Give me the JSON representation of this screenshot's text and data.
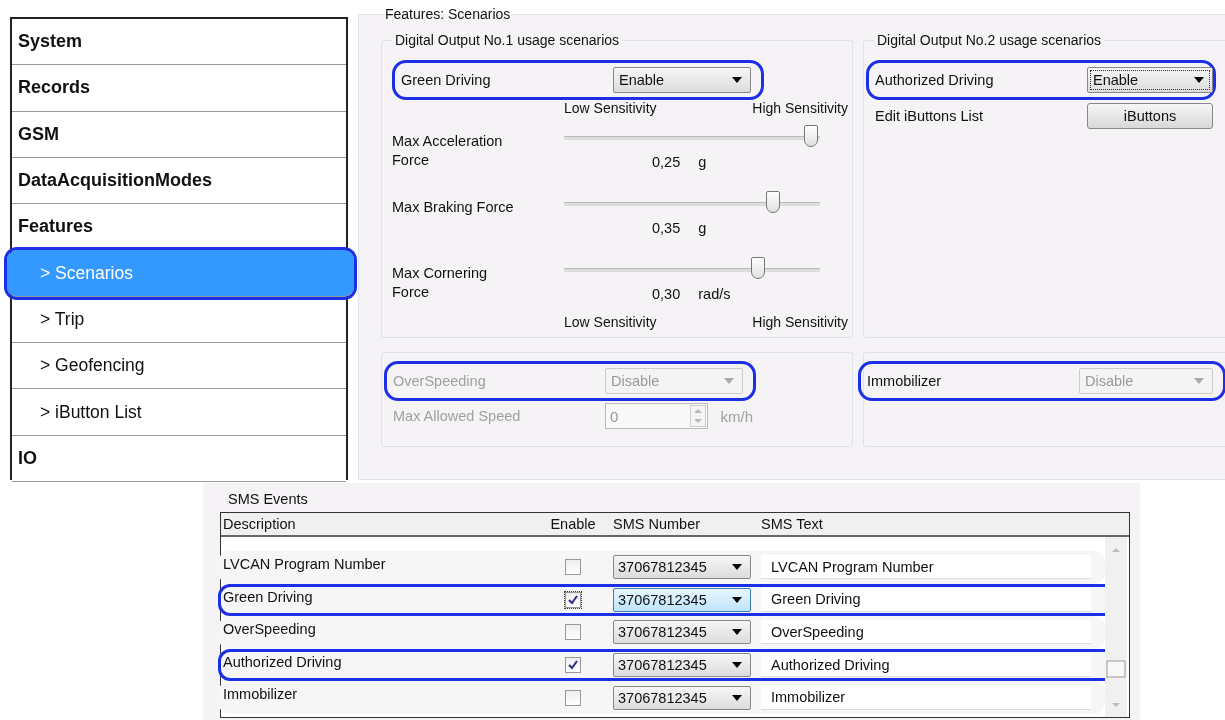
{
  "sidebar": {
    "items": [
      {
        "label": "System",
        "kind": "section",
        "selected": false,
        "highlighted": false
      },
      {
        "label": "Records",
        "kind": "section",
        "selected": false,
        "highlighted": false
      },
      {
        "label": "GSM",
        "kind": "section",
        "selected": false,
        "highlighted": false
      },
      {
        "label": "DataAcquisitionModes",
        "kind": "section",
        "selected": false,
        "highlighted": false
      },
      {
        "label": "Features",
        "kind": "section",
        "selected": false,
        "highlighted": false
      },
      {
        "label": "> Scenarios",
        "kind": "sub",
        "selected": true,
        "highlighted": true
      },
      {
        "label": "> Trip",
        "kind": "sub",
        "selected": false,
        "highlighted": false
      },
      {
        "label": "> Geofencing",
        "kind": "sub",
        "selected": false,
        "highlighted": false
      },
      {
        "label": "> iButton List",
        "kind": "sub",
        "selected": false,
        "highlighted": false
      },
      {
        "label": "IO",
        "kind": "section",
        "selected": false,
        "highlighted": false
      }
    ]
  },
  "features": {
    "title": "Features: Scenarios",
    "output_1": {
      "title": "Digital Output No.1 usage scenarios",
      "scenario": {
        "label": "Green Driving",
        "value": "Enable",
        "highlighted": true,
        "focused": false
      },
      "scale_top": {
        "low": "Low Sensitivity",
        "high": "High Sensitivity"
      },
      "sliders": [
        {
          "label": "Max Acceleration Force",
          "level": 0.97,
          "reading": "0,25",
          "unit": "g"
        },
        {
          "label": "Max Braking Force",
          "level": 0.82,
          "reading": "0,35",
          "unit": "g"
        },
        {
          "label": "Max Cornering Force",
          "level": 0.76,
          "reading": "0,30",
          "unit": "rad/s"
        }
      ],
      "scale_bottom": {
        "low": "Low Sensitivity",
        "high": "High Sensitivity"
      }
    },
    "output_2": {
      "title": "Digital Output No.2 usage scenarios",
      "scenario": {
        "label": "Authorized Driving",
        "value": "Enable",
        "highlighted": true,
        "focused": true
      },
      "ibuttons": {
        "label": "Edit iButtons List",
        "button": "iButtons"
      }
    },
    "overspeeding": {
      "label": "OverSpeeding",
      "disabled": true,
      "value": "Disable",
      "highlighted": true,
      "speed": {
        "label": "Max Allowed Speed",
        "value": "0",
        "unit": "km/h"
      }
    },
    "immobilizer": {
      "label": "Immobilizer",
      "disabled": false,
      "value": "Disable",
      "select_disabled": true,
      "highlighted": true
    }
  },
  "sms_events": {
    "title": "SMS Events",
    "columns": [
      "Description",
      "Enable",
      "SMS Number",
      "SMS Text"
    ],
    "rows": [
      {
        "description": "LVCAN Program Number",
        "checked": false,
        "number": "37067812345",
        "text": "LVCAN Program Number",
        "highlighted": false,
        "focused": false
      },
      {
        "description": "Green Driving",
        "checked": true,
        "number": "37067812345",
        "text": "Green Driving",
        "highlighted": true,
        "focused": true
      },
      {
        "description": "OverSpeeding",
        "checked": false,
        "number": "37067812345",
        "text": "OverSpeeding",
        "highlighted": false,
        "focused": false
      },
      {
        "description": "Authorized Driving",
        "checked": true,
        "number": "37067812345",
        "text": "Authorized Driving",
        "highlighted": true,
        "focused": false
      },
      {
        "description": "Immobilizer",
        "checked": false,
        "number": "37067812345",
        "text": "Immobilizer",
        "highlighted": false,
        "focused": false
      }
    ]
  }
}
